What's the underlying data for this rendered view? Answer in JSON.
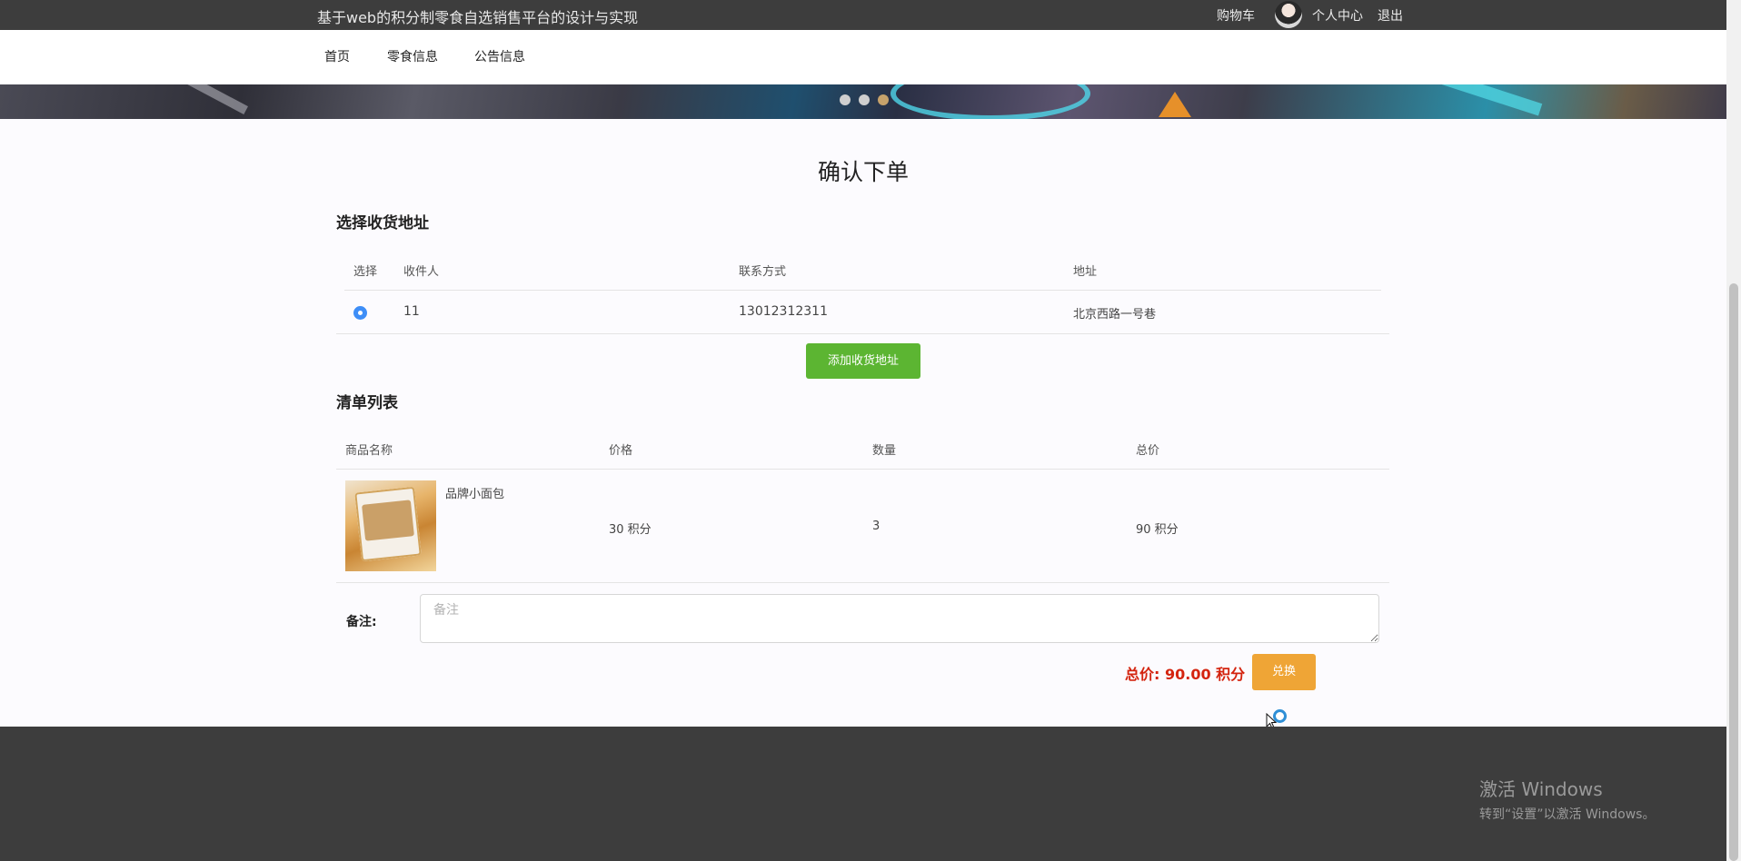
{
  "header": {
    "site_title": "基于web的积分制零食自选销售平台的设计与实现",
    "cart": "购物车",
    "profile": "个人中心",
    "logout": "退出"
  },
  "nav": {
    "items": [
      "首页",
      "零食信息",
      "公告信息"
    ]
  },
  "banner": {
    "slide_count": 3,
    "active_slide": 3
  },
  "page": {
    "title": "确认下单"
  },
  "address_section": {
    "title": "选择收货地址",
    "columns": [
      "选择",
      "收件人",
      "联系方式",
      "地址"
    ],
    "rows": [
      {
        "selected": true,
        "recipient": "11",
        "phone": "13012312311",
        "address": "北京西路一号巷"
      }
    ],
    "add_button": "添加收货地址"
  },
  "order_section": {
    "title": "清单列表",
    "columns": [
      "商品名称",
      "价格",
      "数量",
      "总价"
    ],
    "items": [
      {
        "name": "品牌小面包",
        "price": "30 积分",
        "quantity": "3",
        "subtotal": "90 积分"
      }
    ]
  },
  "remark": {
    "label": "备注:",
    "placeholder": "备注",
    "value": ""
  },
  "checkout": {
    "total_text": "总价:  90.00 积分",
    "submit_label": "兑换",
    "total_color": "#d4240f"
  },
  "watermark": {
    "line1": "激活 Windows",
    "line2": "转到“设置”以激活 Windows。"
  },
  "colors": {
    "topbar": "#3d3d3d",
    "green_button": "#5cb532",
    "orange_button": "#efa536",
    "radio": "#3e8ef7"
  }
}
